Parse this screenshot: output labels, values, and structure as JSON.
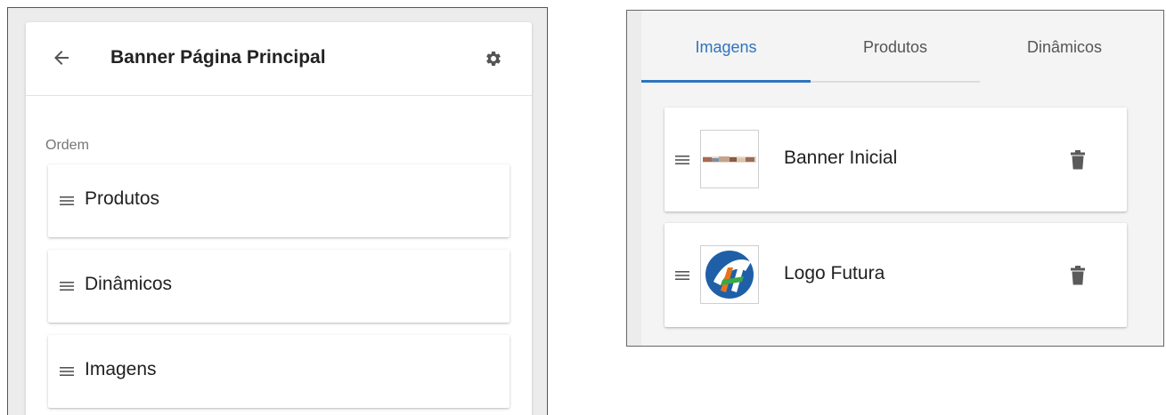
{
  "left_panel": {
    "header": {
      "title": "Banner Página Principal",
      "back_icon": "arrow-left-icon",
      "settings_icon": "gear-icon"
    },
    "order_label": "Ordem",
    "order_items": [
      {
        "label": "Produtos",
        "icon": "drag-handle-icon"
      },
      {
        "label": "Dinâmicos",
        "icon": "drag-handle-icon"
      },
      {
        "label": "Imagens",
        "icon": "drag-handle-icon"
      }
    ]
  },
  "right_panel": {
    "tabs": [
      {
        "label": "Imagens",
        "active": true
      },
      {
        "label": "Produtos",
        "active": false
      },
      {
        "label": "Dinâmicos",
        "active": false
      }
    ],
    "images": [
      {
        "name": "Banner Inicial",
        "thumbnail": "banner-thumbnail",
        "delete_icon": "trash-icon"
      },
      {
        "name": "Logo Futura",
        "thumbnail": "logo-thumbnail",
        "delete_icon": "trash-icon"
      }
    ]
  },
  "colors": {
    "accent": "#2e74c0",
    "panel_background": "#ececec",
    "icon_gray": "#616161"
  }
}
